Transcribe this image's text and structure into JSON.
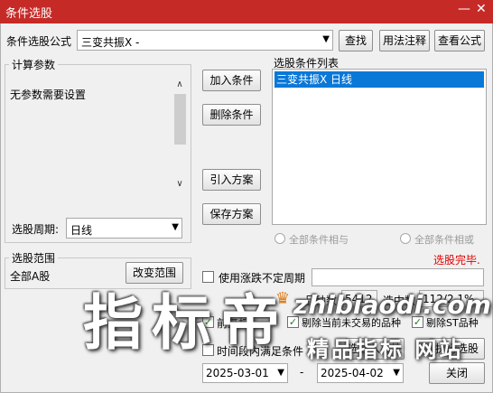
{
  "window": {
    "title": "条件选股"
  },
  "formula": {
    "label": "条件选股公式",
    "value": "三变共振X  -",
    "find_btn": "查找",
    "usage_btn": "用法注释",
    "view_btn": "查看公式"
  },
  "params": {
    "title": "计算参数",
    "text": "无参数需要设置"
  },
  "period": {
    "label": "选股周期:",
    "value": "日线"
  },
  "actions": {
    "add": "加入条件",
    "delete": "删除条件",
    "import": "引入方案",
    "save": "保存方案"
  },
  "conditions": {
    "title": "选股条件列表",
    "items": [
      "三变共振X  日线"
    ]
  },
  "logic": {
    "and": "全部条件相与",
    "or": "全部条件相或"
  },
  "status": {
    "done": "选股完毕.",
    "done_color": "#e00000"
  },
  "range": {
    "title": "选股范围",
    "value": "全部A股",
    "change_btn": "改变范围"
  },
  "uncertain": {
    "label": "使用涨跌不定周期"
  },
  "stats": {
    "count_label": "品种数",
    "count_value": "5412",
    "selected_label": "选中数",
    "selected_value": "112/2.1%"
  },
  "options": {
    "fq": "前复权",
    "exclude_halt": "剔除当前未交易的品种",
    "exclude_st": "剔除ST品种"
  },
  "time": {
    "label": "时间段内满足条件",
    "from": "2025-03-01",
    "sep": "-",
    "to": "2025-04-02"
  },
  "bottom": {
    "select_board": "选股入板块",
    "execute": "执行选股",
    "close": "关闭"
  },
  "watermark": {
    "big": "指标帝",
    "url": "zhibiaodi.com",
    "brand": "精品指标 网站"
  }
}
